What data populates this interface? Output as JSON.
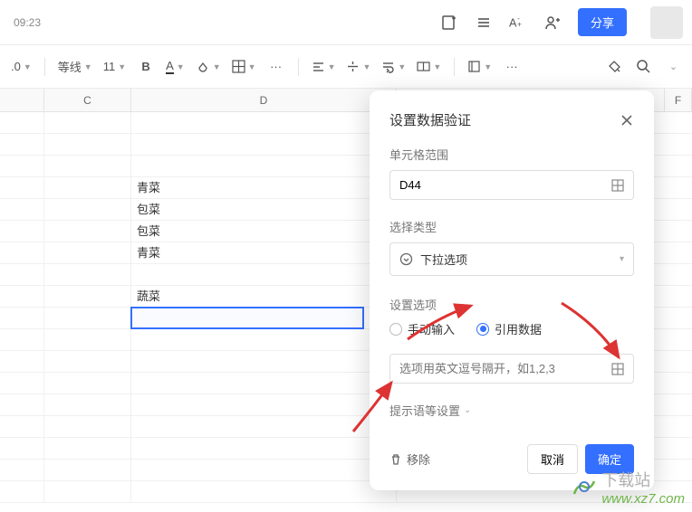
{
  "topbar": {
    "time": "09:23",
    "share_label": "分享"
  },
  "toolbar": {
    "number_fmt": ".0",
    "line_style": "等线",
    "font_size": "11",
    "bold": "B",
    "font_color": "A",
    "more": "···"
  },
  "columns": {
    "C": "C",
    "D": "D",
    "F": "F"
  },
  "cells": {
    "d1": "青菜",
    "d2": "包菜",
    "d3": "包菜",
    "d4": "青菜",
    "d5": "蔬菜"
  },
  "panel": {
    "title": "设置数据验证",
    "range_label": "单元格范围",
    "range_value": "D44",
    "type_label": "选择类型",
    "type_value": "下拉选项",
    "options_label": "设置选项",
    "radio_manual": "手动输入",
    "radio_ref": "引用数据",
    "options_placeholder": "选项用英文逗号隔开，如1,2,3",
    "more_settings": "提示语等设置",
    "remove": "移除",
    "cancel": "取消",
    "ok": "确定"
  },
  "watermark": {
    "zh": "下载站",
    "url": "www.xz7.com"
  }
}
